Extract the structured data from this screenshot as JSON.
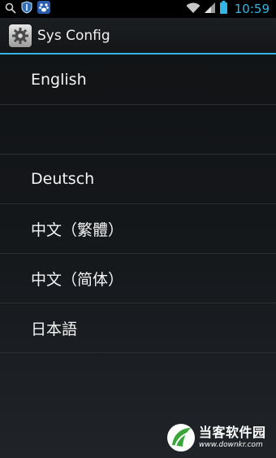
{
  "status_bar": {
    "time": "10:59",
    "left_icons": [
      "search-icon",
      "shield-icon",
      "paw-icon"
    ],
    "right_icons": [
      "wifi-icon",
      "signal-icon",
      "battery-icon"
    ]
  },
  "action_bar": {
    "title": "Sys Config",
    "icon": "settings-gear-icon"
  },
  "languages": [
    "English",
    "",
    "Deutsch",
    "中文（繁體）",
    "中文（简体）",
    "日本語"
  ],
  "watermark": {
    "brand": "当客软件园",
    "url": "www.downkr.com"
  },
  "colors": {
    "accent": "#33b5e5",
    "text": "#f4f4f4",
    "divider": "#2c3034",
    "watermark_logo": "#3aa63a"
  }
}
